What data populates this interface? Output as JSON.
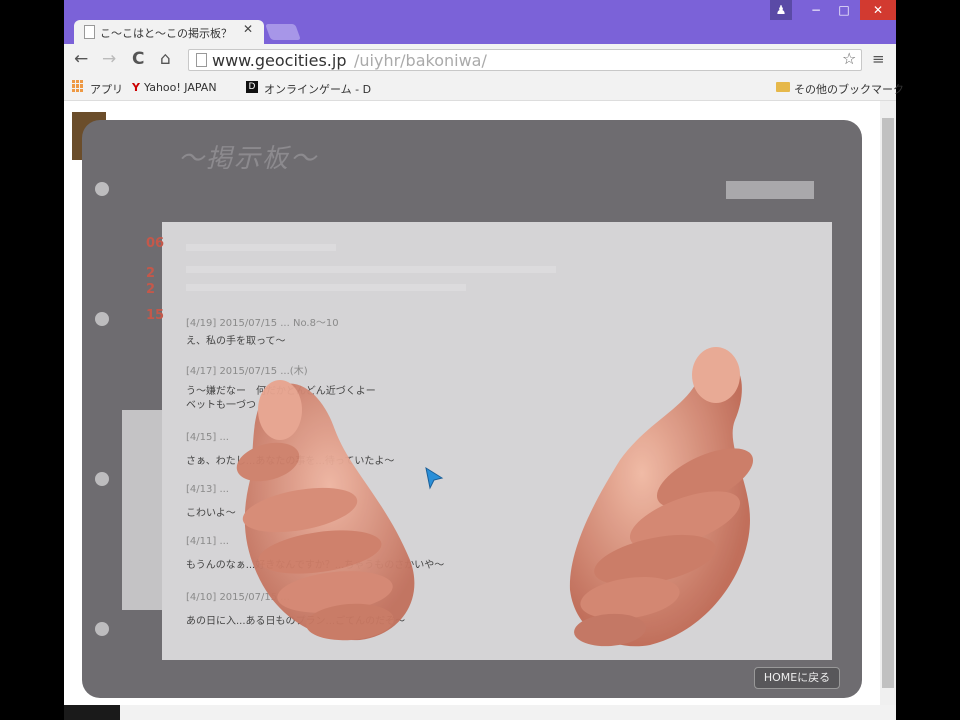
{
  "browser": {
    "tab_title": "こ〜こはと〜この掲示板？",
    "url_domain": "www.geocities.jp",
    "url_path": "/uiyhr/bakoniwa/",
    "nav": {
      "back": "←",
      "forward": "→",
      "reload": "C",
      "home": "⌂"
    },
    "window_buttons": {
      "user": "♟",
      "minimize": "−",
      "maximize": "□",
      "close": "✕"
    },
    "bookmarks": {
      "apps": "アプリ",
      "yahoo": "Yahoo! JAPAN",
      "online_game": "オンラインゲーム - D",
      "other": "その他のブックマーク"
    }
  },
  "board": {
    "title": "〜掲示板〜",
    "home_button": "HOMEに戻る",
    "date_marks": [
      "06",
      "2",
      "2",
      "15"
    ],
    "posts": [
      {
        "header": "[4/19]  2015/07/15  ...  No.8〜10",
        "body": "え、私の手を取って〜"
      },
      {
        "header": "[4/17]  2015/07/15  ...(木)",
        "body": "う〜嫌だなー　何だかどんどん近づくよー",
        "body2": "ベットも一づつ"
      },
      {
        "header": "[4/15]  ...",
        "body": "さぁ、わたし...あなたの事を...待っていたよ〜"
      },
      {
        "header": "[4/13]  ...",
        "body": "こわいよ〜"
      },
      {
        "header": "[4/11]  ...",
        "body": "もうんのなぁ...好きなんですか？...ちゃうものさかいや〜"
      },
      {
        "header": "[4/10]  2015/07/15  ...",
        "body": "あの日に入...ある日ものプラン...ごてんのだぞ〜"
      }
    ]
  },
  "colors": {
    "accent": "#7b62d8",
    "board": "#6e6c70",
    "content": "#d5d4d6",
    "date_mark": "#c4584a",
    "skin": "#d98a74"
  },
  "icons": {
    "tab": "page-icon",
    "star": "star-icon",
    "menu": "menu-icon",
    "cursor": "pointer-cursor-icon",
    "folder": "folder-icon"
  }
}
